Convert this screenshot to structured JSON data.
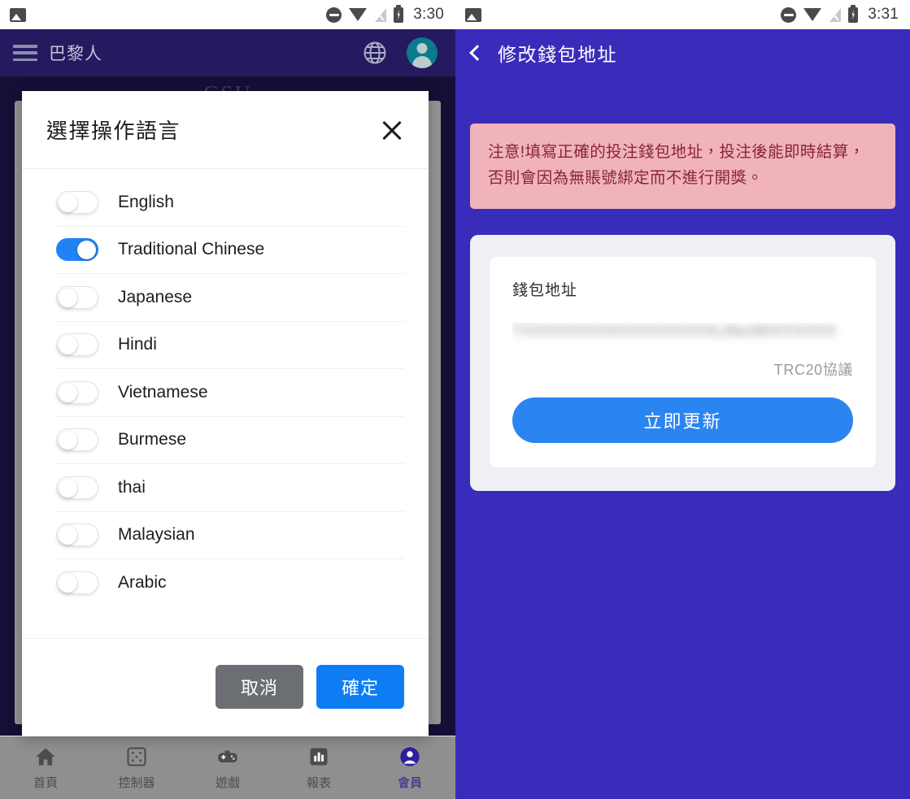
{
  "left_phone": {
    "status_bar": {
      "time": "3:30",
      "icons": [
        "photo-icon",
        "dnd-icon",
        "wifi-icon",
        "signal-off-icon",
        "battery-charging-icon"
      ]
    },
    "app_header": {
      "menu_icon": "hamburger-menu-icon",
      "title": "巴黎人",
      "globe_icon": "globe-icon",
      "avatar_icon": "user-avatar-icon"
    },
    "background": {
      "ghost_text": "GSU"
    },
    "dialog": {
      "title": "選擇操作語言",
      "close_icon": "close-icon",
      "languages": [
        {
          "label": "English",
          "on": false
        },
        {
          "label": "Traditional Chinese",
          "on": true
        },
        {
          "label": "Japanese",
          "on": false
        },
        {
          "label": "Hindi",
          "on": false
        },
        {
          "label": "Vietnamese",
          "on": false
        },
        {
          "label": "Burmese",
          "on": false
        },
        {
          "label": "thai",
          "on": false
        },
        {
          "label": "Malaysian",
          "on": false
        },
        {
          "label": "Arabic",
          "on": false
        }
      ],
      "cancel_label": "取消",
      "confirm_label": "確定"
    },
    "bottom_nav": {
      "items": [
        {
          "label": "首頁",
          "icon": "home-icon",
          "active": false
        },
        {
          "label": "控制器",
          "icon": "dice-icon",
          "active": false
        },
        {
          "label": "遊戲",
          "icon": "gamepad-icon",
          "active": false
        },
        {
          "label": "報表",
          "icon": "bar-chart-icon",
          "active": false
        },
        {
          "label": "會員",
          "icon": "person-icon",
          "active": true
        }
      ]
    }
  },
  "right_phone": {
    "status_bar": {
      "time": "3:31"
    },
    "nav_header": {
      "back_icon": "back-chevron-icon",
      "title": "修改錢包地址"
    },
    "warning": {
      "text": "注意!填寫正確的投注錢包地址，投注後能即時結算，否則會因為無賬號綁定而不進行開獎。"
    },
    "wallet_card": {
      "label": "錢包地址",
      "address_masked": "TXXXXXXXXXXXXXXXXXXLi6ezMIXXXXXX",
      "protocol": "TRC20協議",
      "update_label": "立即更新"
    }
  },
  "colors": {
    "left_header_navy": "#251a60",
    "right_bg_violet": "#3a2cbb",
    "toggle_on_blue": "#2181f5",
    "confirm_blue": "#0e7df4",
    "cancel_gray": "#6b6e72",
    "warn_bg_pink": "#f0b3bb",
    "warn_text": "#8a2433",
    "update_blue": "#2b85f0",
    "avatar_teal": "#0a7b8c"
  }
}
